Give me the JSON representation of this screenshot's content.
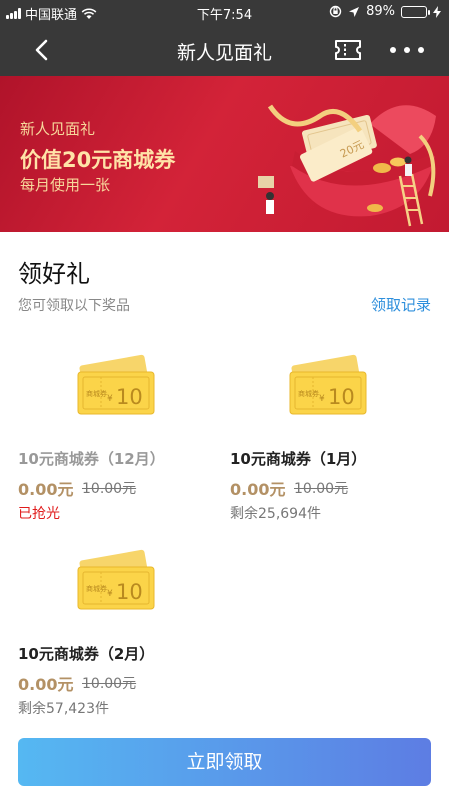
{
  "status_bar": {
    "carrier": "中国联通",
    "time": "下午7:54",
    "battery": "89%",
    "battery_level": 0.89,
    "battery_color": "#3ed15a"
  },
  "nav": {
    "title": "新人见面礼",
    "back_icon": "chevron-left-icon",
    "ticket_icon": "ticket-icon",
    "more_icon": "more-dots-icon"
  },
  "banner": {
    "line1": "新人见面礼",
    "line2": "价值20元商城券",
    "line3": "每月使用一张",
    "coupon_text": "20元"
  },
  "section": {
    "title": "领好礼",
    "subtitle": "您可领取以下奖品",
    "records_link": "领取记录"
  },
  "prizes": [
    {
      "name": "10元商城券（12月）",
      "price": "0.00元",
      "original_price": "10.00元",
      "note": "已抢光",
      "sold_out": true,
      "coupon_label": "商城券",
      "coupon_currency": "¥",
      "coupon_value": "10"
    },
    {
      "name": "10元商城券（1月）",
      "price": "0.00元",
      "original_price": "10.00元",
      "note": "剩余25,694件",
      "sold_out": false,
      "coupon_label": "商城券",
      "coupon_currency": "¥",
      "coupon_value": "10"
    },
    {
      "name": "10元商城券（2月）",
      "price": "0.00元",
      "original_price": "10.00元",
      "note": "剩余57,423件",
      "sold_out": false,
      "coupon_label": "商城券",
      "coupon_currency": "¥",
      "coupon_value": "10"
    }
  ],
  "actions": {
    "claim_button": "立即领取"
  },
  "colors": {
    "accent_blue": "#2e8fdc",
    "price_gold": "#b39165",
    "sold_out_red": "#e01b1b",
    "banner_red": "#d32338"
  }
}
